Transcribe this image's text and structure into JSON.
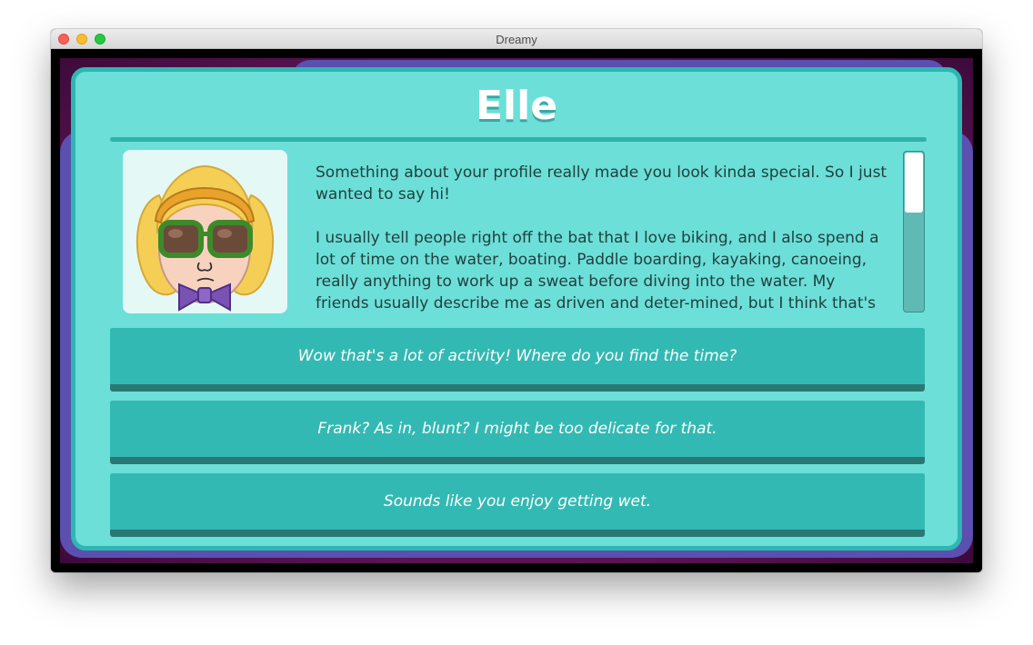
{
  "window": {
    "title": "Dreamy"
  },
  "profile": {
    "name": "Elle",
    "avatar": "elle-avatar-icon",
    "bio": [
      "Something about your profile really made you look kinda special. So I just wanted to say hi!",
      "I usually tell people right off the bat that I love biking, and I also spend a lot of time on the water, boating. Paddle boarding, kayaking, canoeing, really anything to work up a sweat before diving into the water. My friends usually describe me as driven and deter-mined, but I think that's just"
    ]
  },
  "choices": [
    {
      "label": "Wow that's a lot of activity! Where do you find the time?"
    },
    {
      "label": "Frank? As in, blunt? I might be too delicate for that."
    },
    {
      "label": "Sounds like you enjoy getting wet."
    }
  ],
  "colors": {
    "panel": "#6cdfd8",
    "panel_border": "#2db7b0",
    "button": "#33b9b3",
    "button_shadow": "#2a7873",
    "frame": "#5b4fb0",
    "backdrop": "#5a1456"
  }
}
